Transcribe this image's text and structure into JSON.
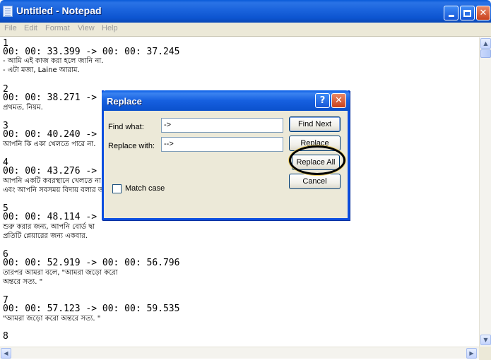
{
  "window": {
    "title": "Untitled - Notepad",
    "controls": {
      "help": "?",
      "close": "✕",
      "min_icon": "minimize-icon",
      "max_icon": "maximize-icon",
      "close_icon": "close-icon"
    }
  },
  "menu": [
    "File",
    "Edit",
    "Format",
    "View",
    "Help"
  ],
  "editor": {
    "lines": [
      "1",
      "00: 00: 33.399 -> 00: 00: 37.245",
      "- আমি এই কাজ করা হলে জানি না.",
      "- এটা মজা, Laine আরাম.",
      "2",
      "00: 00: 38.271 ->",
      "প্রথমত, নিয়ম.",
      "3",
      "00: 00: 40.240 ->",
      "আপনি কি একা খেলতে পারে না.",
      "4",
      "00: 00: 43.276 ->",
      "আপনি একটি কবরস্থানে খেলতে না",
      "এবং আপনি সবসময় বিদায় বলার জ",
      "5",
      "00: 00: 48.114 ->",
      "শুরু করার জন্য, আপনি বোর্ড দ্বা",
      "প্রতিটি প্লেয়ারের জন্য একবার.",
      "6",
      "00: 00: 52.919 -> 00: 00: 56.796",
      "তারপর আমরা বলে, \"আমরা জড়ো করো",
      "অন্তরে সত্য. \"",
      "7",
      "00: 00: 57.123 -> 00: 00: 59.535",
      "\"আমরা জড়ো করো অন্তরে সত্য. \"",
      "8"
    ]
  },
  "dialog": {
    "title": "Replace",
    "find_label": "Find what:",
    "find_value": "->",
    "replace_label": "Replace with:",
    "replace_value": "-->",
    "match_case_label": "Match case",
    "match_case_checked": false,
    "buttons": {
      "find_next": "Find Next",
      "replace": "Replace",
      "replace_all": "Replace All",
      "cancel": "Cancel"
    }
  },
  "colors": {
    "titlebar": "#0c54d0",
    "dialog_face": "#ece9d8",
    "close_button": "#c9401c"
  }
}
